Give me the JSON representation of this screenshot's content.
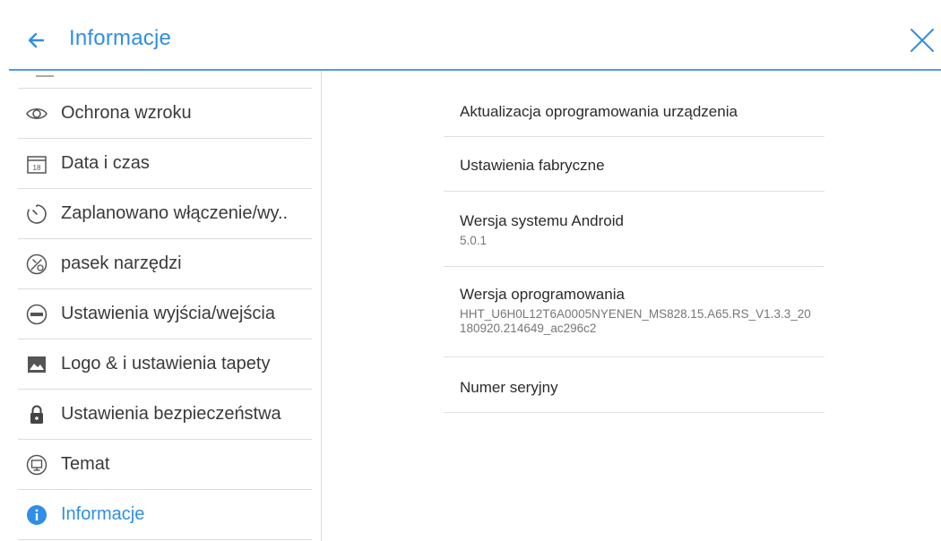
{
  "header": {
    "title": "Informacje",
    "accent_color": "#2f8ee6",
    "back_icon": "arrow-left-icon",
    "close_icon": "close-icon"
  },
  "sidebar": {
    "items": [
      {
        "label": "Ochrona wzroku",
        "icon": "eye-icon"
      },
      {
        "label": "Data i czas",
        "icon": "calendar-icon",
        "icon_text": "18"
      },
      {
        "label": "Zaplanowano włączenie/wy..",
        "icon": "timer-icon"
      },
      {
        "label": "pasek narzędzi",
        "icon": "toolbar-icon"
      },
      {
        "label": "Ustawienia wyjścia/wejścia",
        "icon": "input-output-icon"
      },
      {
        "label": "Logo & i ustawienia tapety",
        "icon": "image-icon"
      },
      {
        "label": "Ustawienia bezpieczeństwa",
        "icon": "lock-icon"
      },
      {
        "label": "Temat",
        "icon": "theme-icon"
      },
      {
        "label": "Informacje",
        "icon": "info-icon",
        "active": true
      }
    ]
  },
  "info": {
    "rows": [
      {
        "title": "Aktualizacja oprogramowania urządzenia"
      },
      {
        "title": "Ustawienia fabryczne"
      },
      {
        "title": "Wersja systemu Android",
        "value": "5.0.1"
      },
      {
        "title": "Wersja oprogramowania",
        "value": "HHT_U6H0L12T6A0005NYENEN_MS828.15.A65.RS_V1.3.3_20180920.214649_ac296c2"
      },
      {
        "title": "Numer seryjny"
      }
    ]
  }
}
